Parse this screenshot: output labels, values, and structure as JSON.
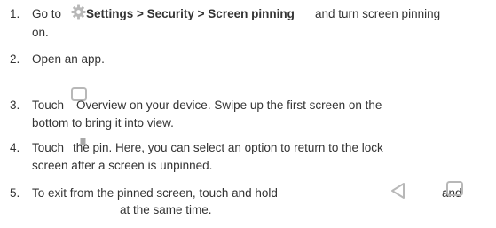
{
  "steps": [
    {
      "number": "1.",
      "prefix": "Go to",
      "bold_text": "Settings > Security > Screen pinning",
      "suffix": "and turn screen pinning",
      "line2": "on.",
      "icon": "gear-icon"
    },
    {
      "number": "2.",
      "text": "Open an app."
    },
    {
      "number": "3.",
      "prefix": "Touch",
      "suffix": "Overview on your device. Swipe up the first screen on the",
      "line2": "bottom to bring it into view.",
      "icon": "overview-icon"
    },
    {
      "number": "4.",
      "prefix": "Touch",
      "suffix": "the pin. Here, you can select an option to return to the lock",
      "line2": "screen after a screen is unpinned.",
      "icon": "pin-icon"
    },
    {
      "number": "5.",
      "prefix": "To exit from the pinned screen, touch and hold",
      "middle": "and",
      "line2": "at the same time.",
      "icons": [
        "back-icon",
        "overview-icon"
      ]
    }
  ],
  "colors": {
    "text": "#333333",
    "icon": "#b8b8b8"
  }
}
